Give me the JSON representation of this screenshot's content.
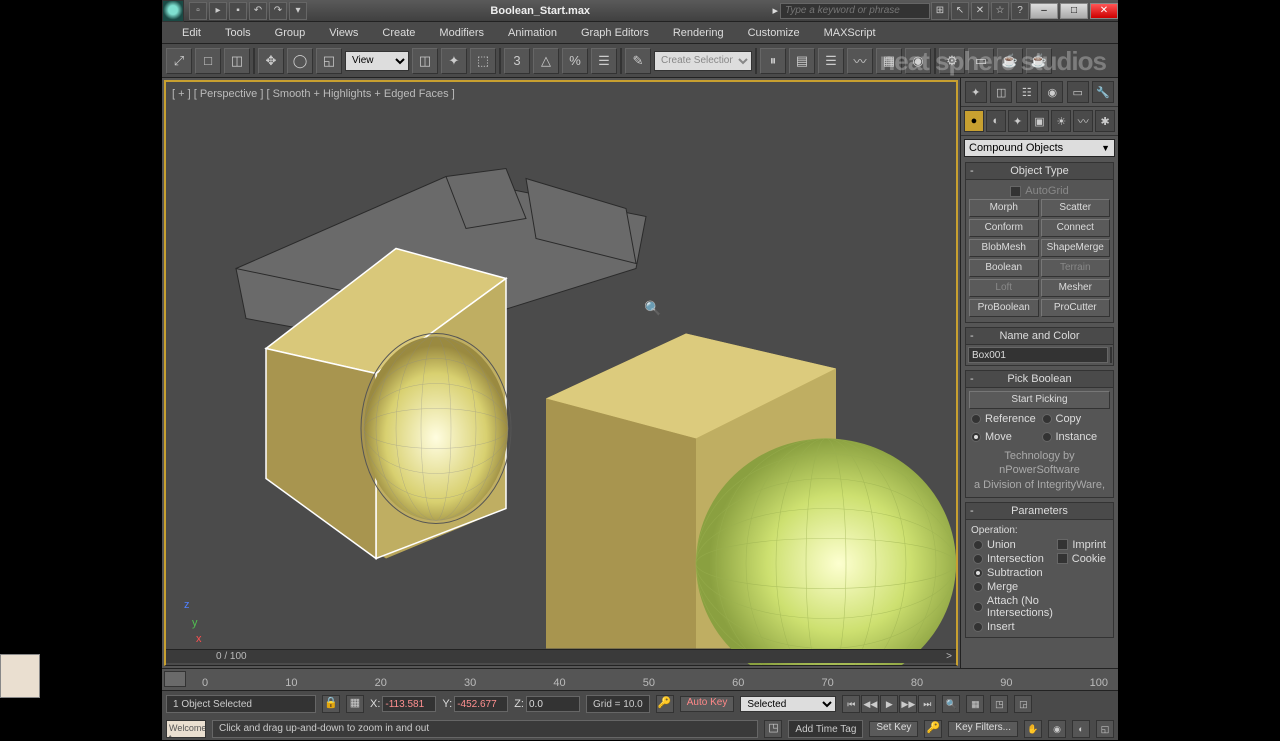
{
  "title": "Boolean_Start.max",
  "search_placeholder": "Type a keyword or phrase",
  "menus": [
    "Edit",
    "Tools",
    "Group",
    "Views",
    "Create",
    "Modifiers",
    "Animation",
    "Graph Editors",
    "Rendering",
    "Customize",
    "MAXScript"
  ],
  "tool_select": "View",
  "tool_sel2": "Create Selection Se",
  "viewport_label": "[ + ] [ Perspective ] [ Smooth + Highlights + Edged Faces ]",
  "frames": "0 / 100",
  "frame_r": ">",
  "panel_combo": "Compound Objects",
  "rollouts": {
    "object_type": "Object Type",
    "autogrid": "AutoGrid",
    "buttons": [
      "Morph",
      "Scatter",
      "Conform",
      "Connect",
      "BlobMesh",
      "ShapeMerge",
      "Boolean",
      "Terrain",
      "Loft",
      "Mesher",
      "ProBoolean",
      "ProCutter"
    ],
    "name_color": "Name and Color",
    "object_name": "Box001",
    "pick_boolean": "Pick Boolean",
    "start_picking": "Start Picking",
    "reference": "Reference",
    "copy": "Copy",
    "move": "Move",
    "instance": "Instance",
    "credit1": "Technology by nPowerSoftware",
    "credit2": "a Division of IntegrityWare,",
    "parameters": "Parameters",
    "operation": "Operation:",
    "ops": [
      "Union",
      "Intersection",
      "Subtraction",
      "Merge",
      "Attach (No Intersections)",
      "Insert"
    ],
    "imprint": "Imprint",
    "cookie": "Cookie"
  },
  "ticks": [
    "0",
    "10",
    "20",
    "30",
    "40",
    "50",
    "60",
    "70",
    "80",
    "90",
    "100"
  ],
  "status": {
    "selected": "1 Object Selected",
    "x_label": "X:",
    "x": "-113.581",
    "y_label": "Y:",
    "y": "-452.677",
    "z_label": "Z:",
    "z": "0.0",
    "grid": "Grid = 10.0",
    "autokey": "Auto Key",
    "setkey": "Set Key",
    "keysel": "Selected",
    "keyfilters": "Key Filters...",
    "prompt": "Welcome t",
    "hint": "Click and drag up-and-down to zoom in and out",
    "addtag": "Add Time Tag"
  },
  "watermark": "neat sphere studios"
}
